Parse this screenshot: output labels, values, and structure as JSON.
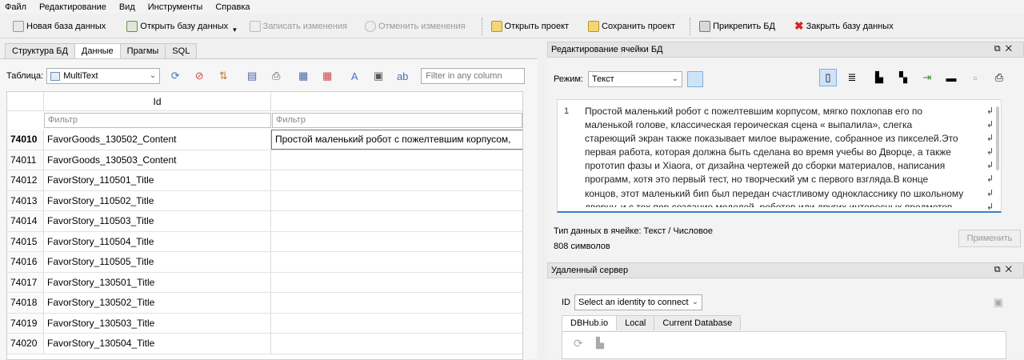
{
  "menu": [
    "Файл",
    "Редактирование",
    "Вид",
    "Инструменты",
    "Справка"
  ],
  "toolbar": {
    "new_db": "Новая база данных",
    "open_db": "Открыть базу данных",
    "write_changes": "Записать изменения",
    "revert_changes": "Отменить изменения",
    "open_project": "Открыть проект",
    "save_project": "Сохранить проект",
    "attach_db": "Прикрепить БД",
    "close_db": "Закрыть базу данных"
  },
  "left_tabs": [
    "Структура БД",
    "Данные",
    "Прагмы",
    "SQL"
  ],
  "table_bar": {
    "label": "Таблица:",
    "table_name": "MultiText",
    "filter_all_placeholder": "Filter in any column"
  },
  "grid": {
    "column_header": "Id",
    "filter_placeholder": "Фильтр",
    "rows": [
      {
        "num": "74010",
        "id": "FavorGoods_130502_Content",
        "text": "Простой маленький робот с пожелтевшим корпусом,"
      },
      {
        "num": "74011",
        "id": "FavorGoods_130503_Content",
        "text": ""
      },
      {
        "num": "74012",
        "id": "FavorStory_110501_Title",
        "text": ""
      },
      {
        "num": "74013",
        "id": "FavorStory_110502_Title",
        "text": ""
      },
      {
        "num": "74014",
        "id": "FavorStory_110503_Title",
        "text": ""
      },
      {
        "num": "74015",
        "id": "FavorStory_110504_Title",
        "text": ""
      },
      {
        "num": "74016",
        "id": "FavorStory_110505_Title",
        "text": ""
      },
      {
        "num": "74017",
        "id": "FavorStory_130501_Title",
        "text": ""
      },
      {
        "num": "74018",
        "id": "FavorStory_130502_Title",
        "text": ""
      },
      {
        "num": "74019",
        "id": "FavorStory_130503_Title",
        "text": ""
      },
      {
        "num": "74020",
        "id": "FavorStory_130504_Title",
        "text": ""
      }
    ]
  },
  "edit_panel": {
    "title": "Редактирование ячейки БД",
    "mode_label": "Режим:",
    "mode_value": "Текст",
    "line_number": "1",
    "cell_lines": [
      "Простой маленький робот с пожелтевшим корпусом, мягко похлопав его по",
      "маленькой голове, классическая героическая сцена « выпалила», слегка",
      "стареющий экран также показывает милое выражение, собранное из пикселей.Это",
      "первая работа, которая должна быть сделана во время учебы во Дворце, а также",
      "прототип фазы и Xiaora, от дизайна чертежей до сборки материалов, написания",
      "программ, хотя это первый тест, но творческий ум с первого взгляда.В конце",
      "концов, этот маленький бип был передан счастливому однокласснику по школьному",
      "дворцу, и с тех пор создание моделей, роботов или других интересных предметов"
    ],
    "data_type": "Тип данных в ячейке: Текст / Числовое",
    "char_count": "808 символов",
    "apply": "Применить"
  },
  "remote_panel": {
    "title": "Удаленный сервер",
    "id_label": "ID",
    "identity_value": "Select an identity to connect",
    "tabs": [
      "DBHub.io",
      "Local",
      "Current Database"
    ]
  }
}
